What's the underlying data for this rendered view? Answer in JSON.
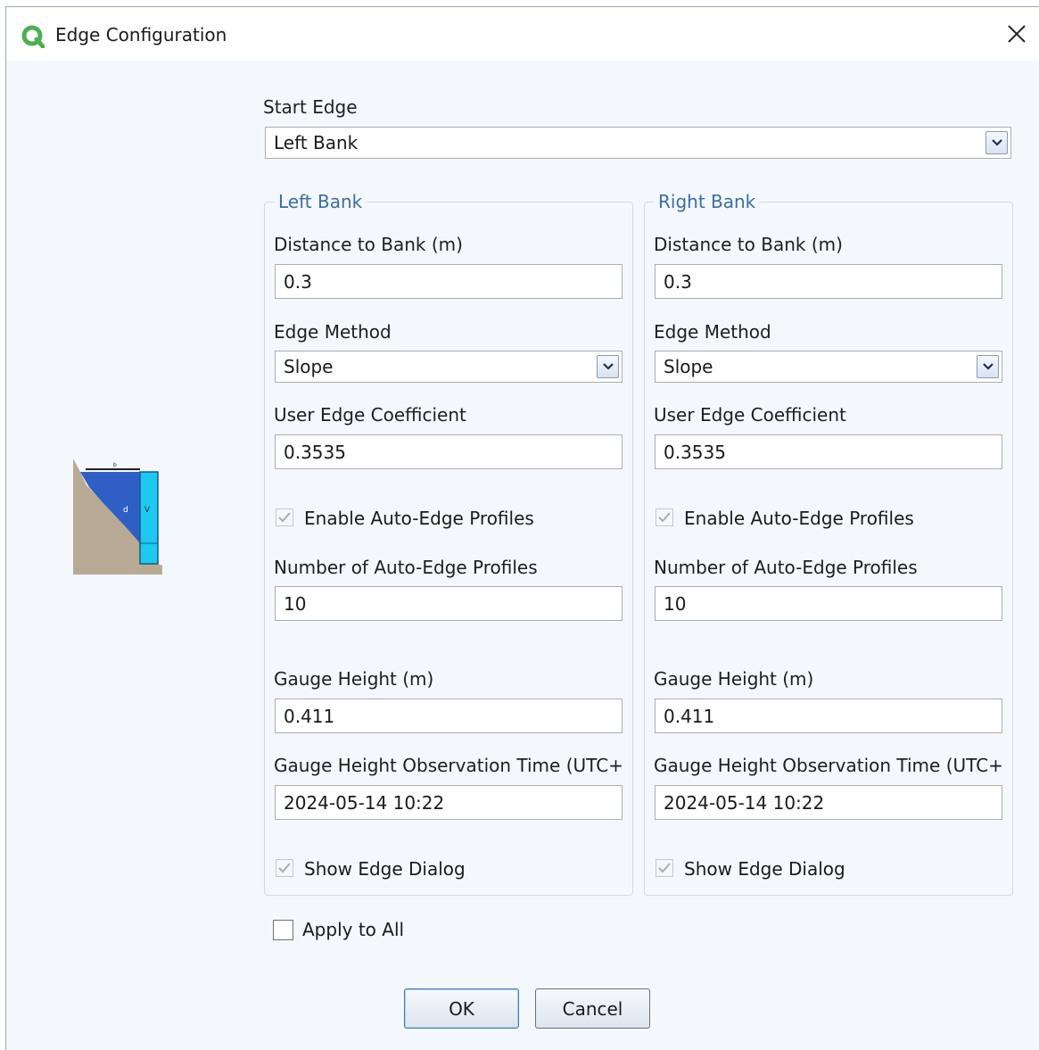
{
  "window": {
    "title": "Edge Configuration"
  },
  "start_edge": {
    "label": "Start Edge",
    "value": "Left Bank"
  },
  "left": {
    "group_title": "Left Bank",
    "distance_label": "Distance to Bank (m)",
    "distance_value": "0.3",
    "method_label": "Edge Method",
    "method_value": "Slope",
    "coef_label": "User Edge Coefficient",
    "coef_value": "0.3535",
    "auto_label": "Enable Auto-Edge Profiles",
    "auto_checked": true,
    "num_label": "Number of Auto-Edge Profiles",
    "num_value": "10",
    "gauge_label": "Gauge Height (m)",
    "gauge_value": "0.411",
    "obs_label": "Gauge Height Observation Time (UTC+'",
    "obs_value": "2024-05-14 10:22",
    "show_label": "Show Edge Dialog",
    "show_checked": true
  },
  "right": {
    "group_title": "Right Bank",
    "distance_label": "Distance to Bank (m)",
    "distance_value": "0.3",
    "method_label": "Edge Method",
    "method_value": "Slope",
    "coef_label": "User Edge Coefficient",
    "coef_value": "0.3535",
    "auto_label": "Enable Auto-Edge Profiles",
    "auto_checked": true,
    "num_label": "Number of Auto-Edge Profiles",
    "num_value": "10",
    "gauge_label": "Gauge Height (m)",
    "gauge_value": "0.411",
    "obs_label": "Gauge Height Observation Time (UTC+'",
    "obs_value": "2024-05-14 10:22",
    "show_label": "Show Edge Dialog",
    "show_checked": true
  },
  "apply_all": {
    "label": "Apply to All",
    "checked": false
  },
  "buttons": {
    "ok": "OK",
    "cancel": "Cancel"
  },
  "icons": {
    "app": "app-logo-icon",
    "close": "close-icon",
    "dropdown": "chevron-down-icon",
    "check": "checkmark-icon"
  },
  "colors": {
    "accent": "#3a6ea5",
    "app_icon": "#4caf50",
    "water": "#2f5fc4",
    "instrument": "#1ec8f0"
  }
}
